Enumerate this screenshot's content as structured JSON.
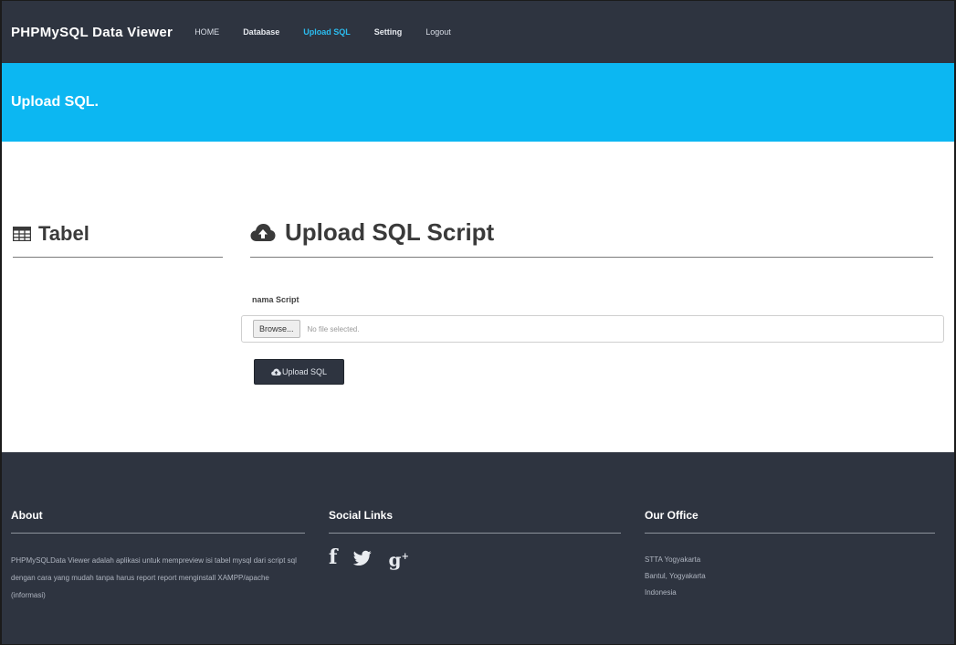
{
  "navbar": {
    "brand": "PHPMySQL Data Viewer",
    "links": [
      {
        "label": "HOME"
      },
      {
        "label": "Database"
      },
      {
        "label": "Upload SQL"
      },
      {
        "label": "Setting"
      },
      {
        "label": "Logout"
      }
    ],
    "active": "Upload SQL"
  },
  "banner": {
    "title": "Upload SQL."
  },
  "sidebar": {
    "heading": "Tabel",
    "icon": "table-icon"
  },
  "content": {
    "heading": "Upload SQL Script",
    "icon": "cloud-upload-icon",
    "form": {
      "label": "nama Script",
      "browse_label": "Browse...",
      "file_status": "No file selected.",
      "submit_label": "Upload SQL"
    }
  },
  "footer": {
    "about": {
      "heading": "About",
      "text": "PHPMySQLData Viewer adalah aplikasi untuk mempreview isi tabel mysql dari script sql dengan cara yang mudah tanpa harus report report menginstall XAMPP/apache (informasi)"
    },
    "social": {
      "heading": "Social Links",
      "icons": [
        "facebook-icon",
        "twitter-icon",
        "google-plus-icon"
      ],
      "facebook_glyph": "f",
      "gplus_glyph": "g"
    },
    "office": {
      "heading": "Our Office",
      "lines": [
        "STTA Yogyakarta",
        "Bantul, Yogyakarta",
        "Indonesia"
      ]
    }
  },
  "colors": {
    "navbar_bg": "#2e3440",
    "banner_bg": "#0cb7f2",
    "active_link": "#2bbdf0",
    "footer_bg": "#2e3440"
  }
}
